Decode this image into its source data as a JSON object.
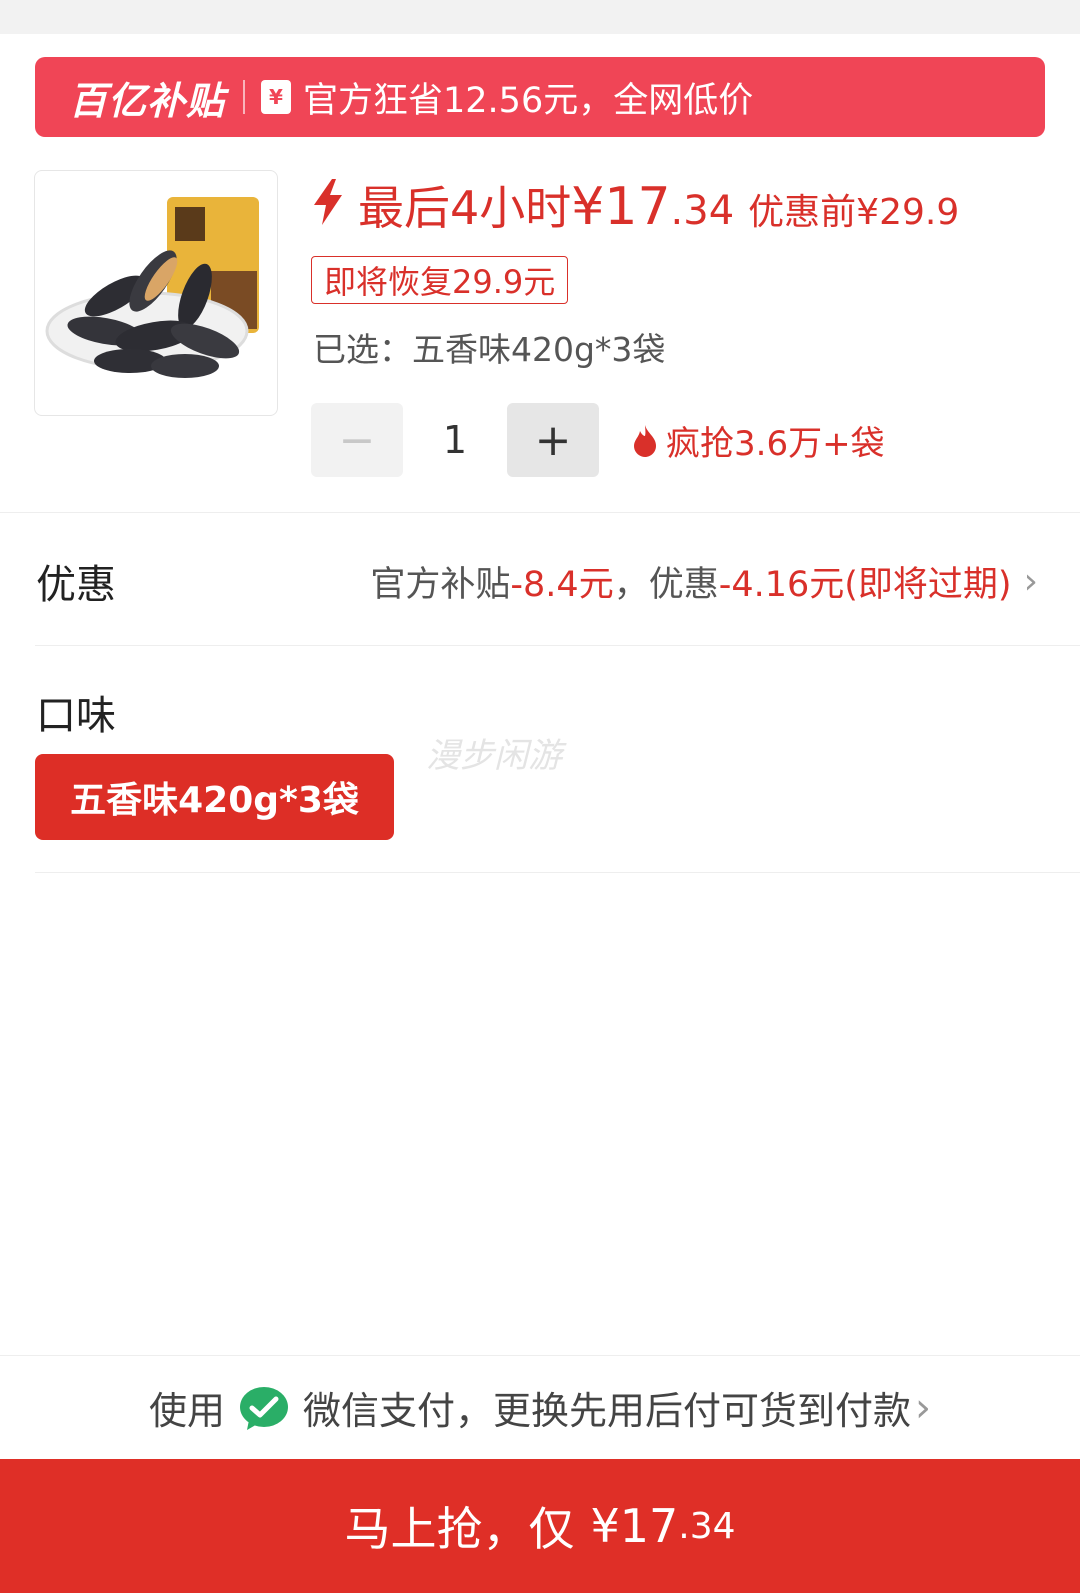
{
  "banner": {
    "logo": "百亿补贴",
    "coupon_icon": "¥",
    "slogan": "官方狂省12.56元，全网低价"
  },
  "product": {
    "image_alt": "sunflower-seeds-product",
    "deadline": "最后4小时",
    "currency": "¥",
    "price_int": "17",
    "price_dec": ".34",
    "before_price": "优惠前¥29.9",
    "restore_tag": "即将恢复29.9元",
    "selected": "已选：五香味420g*3袋"
  },
  "quantity": {
    "minus": "−",
    "value": "1",
    "plus": "+",
    "sold": "疯抢3.6万+袋"
  },
  "discount": {
    "label": "优惠",
    "part1": "官方补贴",
    "amount1": "-8.4元",
    "sep": "，优惠",
    "amount2": "-4.16元(即将过期)",
    "chevron": "›"
  },
  "flavor": {
    "label": "口味",
    "option": "五香味420g*3袋",
    "watermark": "漫步闲游"
  },
  "payment": {
    "prefix": "使用",
    "method": "微信支付，更换先用后付可货到付款",
    "chevron": "›"
  },
  "buy": {
    "label": "马上抢，仅",
    "currency_int": "¥17",
    "dec": ".34"
  },
  "colors": {
    "accent": "#dd2e26",
    "banner": "#f04556",
    "wechat": "#2aae67"
  }
}
